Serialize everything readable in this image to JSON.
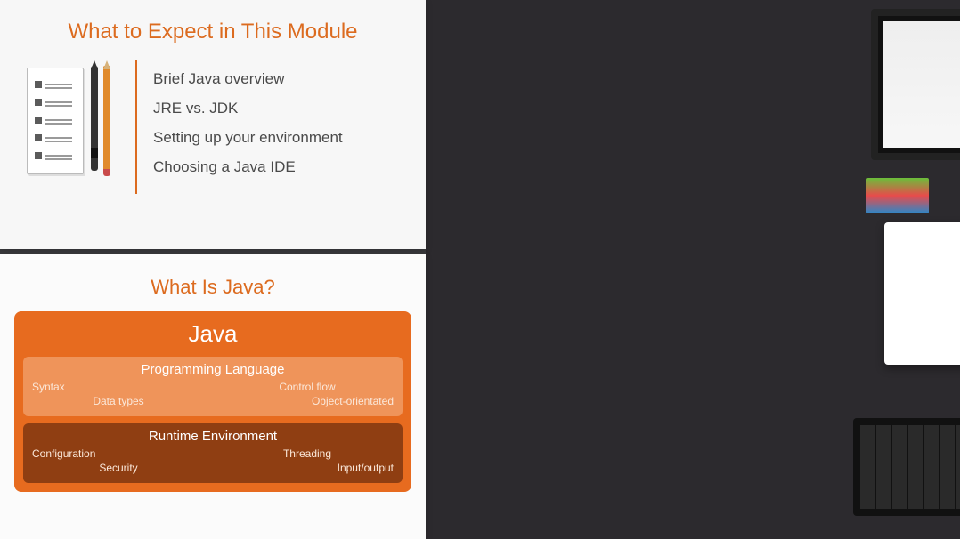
{
  "slide_top": {
    "title": "What to Expect in This Module",
    "bullets": [
      "Brief Java overview",
      "JRE vs. JDK",
      "Setting up your environment",
      "Choosing a Java IDE"
    ]
  },
  "slide_bottom": {
    "title": "What Is Java?",
    "java_card": {
      "title": "Java",
      "lang": {
        "title": "Programming Language",
        "items": [
          "Syntax",
          "Control flow",
          "Data types",
          "Object-orientated"
        ]
      },
      "runtime": {
        "title": "Runtime Environment",
        "items": [
          "Configuration",
          "Threading",
          "Security",
          "Input/output"
        ]
      }
    }
  },
  "colors": {
    "accent": "#dc6b1f",
    "card": "#e76b1f",
    "lang_sub": "#ef945a",
    "runtime_sub": "#8f3e12"
  }
}
